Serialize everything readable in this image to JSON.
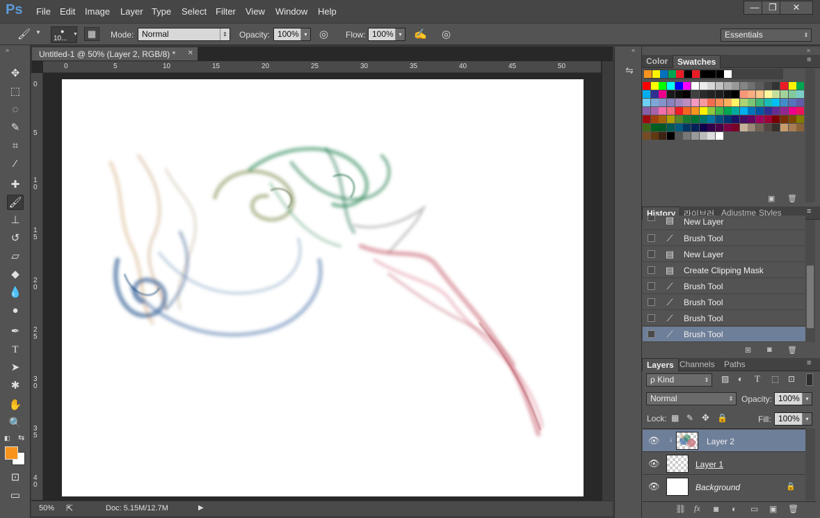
{
  "app": {
    "logo": "Ps"
  },
  "menu": [
    "File",
    "Edit",
    "Image",
    "Layer",
    "Type",
    "Select",
    "Filter",
    "View",
    "Window",
    "Help"
  ],
  "window_controls": {
    "minimize": "—",
    "restore": "❐",
    "close": "✕"
  },
  "options": {
    "brush_size": "10...",
    "mode_label": "Mode:",
    "mode_value": "Normal",
    "opacity_label": "Opacity:",
    "opacity_value": "100%",
    "flow_label": "Flow:",
    "flow_value": "100%",
    "workspace": "Essentials"
  },
  "document": {
    "tab_title": "Untitled-1 @ 50% (Layer 2, RGB/8) *",
    "close": "✕",
    "ruler_top": [
      "0",
      "5",
      "10",
      "15",
      "20",
      "25",
      "30",
      "35",
      "40",
      "45",
      "50"
    ],
    "ruler_left": [
      "0",
      "5",
      "1 0",
      "1 5",
      "2 0",
      "2 5",
      "3 0",
      "3 5",
      "4 0"
    ]
  },
  "status": {
    "zoom": "50%",
    "doc": "Doc: 5.15M/12.7M"
  },
  "color_panel": {
    "tabs": [
      "Color",
      "Swatches"
    ],
    "recent": [
      "#f7941d",
      "#fff200",
      "#0072bc",
      "#00a651",
      "#ed1c24",
      "#000000",
      "#ed1c24",
      "#000000",
      "#000000",
      "#000000",
      "#ffffff"
    ],
    "rows": [
      [
        "#ff0000",
        "#ffff00",
        "#00ff00",
        "#00ffff",
        "#0000ff",
        "#ff00ff",
        "#ffffff",
        "#ebebeb",
        "#d6d6d6",
        "#c2c2c2",
        "#adadad",
        "#999999",
        "#858585",
        "#707070",
        "#5c5c5c",
        "#474747",
        "#333333",
        "#ed1c24",
        "#fff200",
        "#00a651"
      ],
      [
        "#00aeef",
        "#2e3192",
        "#ec008c",
        "#1a1a1a",
        "#0d0d0d",
        "#000000",
        "#404040",
        "#2b2b2b",
        "#222222",
        "#1e1e1e",
        "#111111",
        "#000000",
        "#f7977a",
        "#f9ad81",
        "#fdc68a",
        "#fff79a",
        "#c4df9b",
        "#a3d39c",
        "#82ca9d",
        "#7bcdc8"
      ],
      [
        "#6ecff6",
        "#7ea7d8",
        "#8493ca",
        "#8882be",
        "#a187be",
        "#bc8dbf",
        "#f49ac2",
        "#f6989d",
        "#f26c4f",
        "#f68e55",
        "#fbaf5c",
        "#fff467",
        "#acd372",
        "#7cc576",
        "#3bb878",
        "#1abbb4",
        "#00bff3",
        "#438ccb",
        "#5574b9",
        "#605ca8"
      ],
      [
        "#855fa8",
        "#a763a8",
        "#f06eaa",
        "#f26d7d",
        "#ed1c24",
        "#f26522",
        "#f7941d",
        "#fff200",
        "#8dc73f",
        "#39b54a",
        "#00a651",
        "#00a99d",
        "#00aeef",
        "#0072bc",
        "#0054a6",
        "#2e3192",
        "#662d91",
        "#92278f",
        "#ec008c",
        "#ed145b"
      ],
      [
        "#9e0b0f",
        "#a0410d",
        "#a36209",
        "#aba000",
        "#598527",
        "#1a7b30",
        "#007236",
        "#00746b",
        "#0076a3",
        "#004b80",
        "#003471",
        "#1b1464",
        "#440e62",
        "#630460",
        "#9e005d",
        "#9e0039",
        "#790000",
        "#7b2e00",
        "#7d4900",
        "#827b00"
      ],
      [
        "#406618",
        "#005e20",
        "#005826",
        "#005952",
        "#005b7f",
        "#003663",
        "#002157",
        "#0d004c",
        "#32004b",
        "#4b0049",
        "#7b0046",
        "#7a0026",
        "#c7b299",
        "#998675",
        "#736357",
        "#534741",
        "#37302d",
        "#c69c6d",
        "#a67c52",
        "#8c6239"
      ],
      [
        "#754c24",
        "#603913",
        "#3c2415",
        "#000000",
        "#555555",
        "#777777",
        "#999999",
        "#bbbbbb",
        "#dddddd",
        "#ffffff"
      ]
    ]
  },
  "history_panel": {
    "tabs": [
      "History",
      "라이브러",
      "Adjustme",
      "Styles"
    ],
    "items": [
      {
        "label": "New Layer",
        "icon": "doc-icon"
      },
      {
        "label": "Brush Tool",
        "icon": "brush-icon"
      },
      {
        "label": "New Layer",
        "icon": "doc-icon"
      },
      {
        "label": "Create Clipping Mask",
        "icon": "doc-icon"
      },
      {
        "label": "Brush Tool",
        "icon": "brush-icon"
      },
      {
        "label": "Brush Tool",
        "icon": "brush-icon"
      },
      {
        "label": "Brush Tool",
        "icon": "brush-icon"
      },
      {
        "label": "Brush Tool",
        "icon": "brush-icon"
      }
    ]
  },
  "layers_panel": {
    "tabs": [
      "Layers",
      "Channels",
      "Paths"
    ],
    "filter": "ρ Kind",
    "blend": "Normal",
    "opacity_label": "Opacity:",
    "opacity_value": "100%",
    "lock_label": "Lock:",
    "fill_label": "Fill:",
    "fill_value": "100%",
    "layers": [
      {
        "name": "Layer 2"
      },
      {
        "name": "Layer 1"
      },
      {
        "name": "Background"
      }
    ]
  }
}
